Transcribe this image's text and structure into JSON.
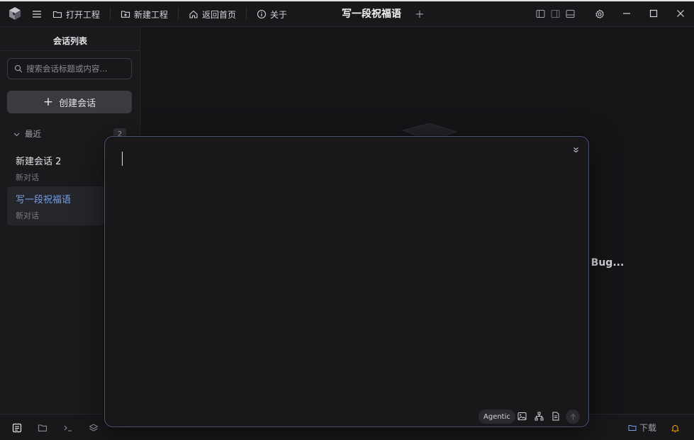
{
  "toolbar": {
    "open_project": "打开工程",
    "new_project": "新建工程",
    "back_home": "返回首页",
    "about": "关于"
  },
  "tab": {
    "title": "写一段祝福语",
    "add_symbol": "+"
  },
  "sidebar": {
    "title": "会话列表",
    "search_placeholder": "搜索会话标题或内容...",
    "create_label": "创建会话",
    "group_label": "最近",
    "group_count": "2",
    "items": [
      {
        "title": "新建会话 2",
        "subtitle": "新对话",
        "active": false
      },
      {
        "title": "写一段祝福语",
        "subtitle": "新对话",
        "active": true
      }
    ]
  },
  "main": {
    "background_hint": "j Bug..."
  },
  "editor": {
    "value": "",
    "mode_label": "Agentic",
    "tools": [
      "image-icon",
      "hierarchy-icon",
      "document-icon",
      "send-arrow-icon"
    ]
  },
  "statusbar": {
    "download_label": "下载",
    "items": [
      "chat-icon",
      "folder-icon",
      "terminal-icon",
      "layers-icon",
      "bell-icon"
    ]
  },
  "colors": {
    "accent": "#7aa0e6",
    "editor_border": "#4a5275",
    "bell": "#f59e0b"
  }
}
